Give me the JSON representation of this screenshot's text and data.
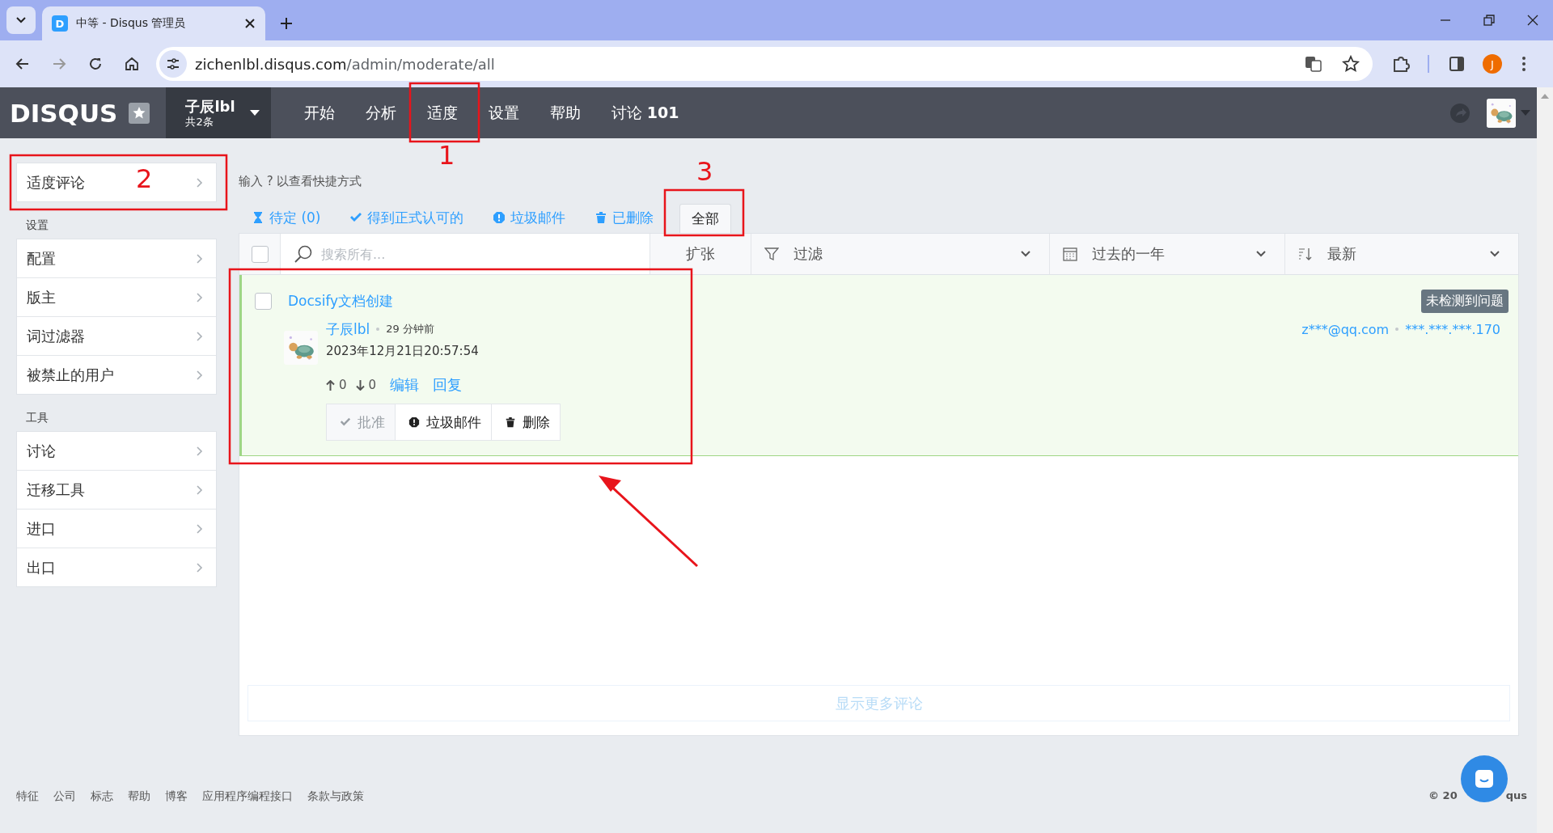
{
  "browser": {
    "tab_title": "中等 - Disqus 管理员",
    "favicon": "D",
    "url": {
      "host": "zichenlbl.disqus.com",
      "path": "/admin/moderate/all"
    },
    "profile_initial": "J"
  },
  "header": {
    "logo": "DISQUS",
    "site": {
      "name": "子辰lbl",
      "count": "共2条"
    },
    "nav": [
      "开始",
      "分析",
      "适度",
      "设置",
      "帮助",
      "讨论 **101**"
    ]
  },
  "sidebar": {
    "top": [
      "适度评论"
    ],
    "sections": [
      {
        "title": "设置",
        "items": [
          "配置",
          "版主",
          "词过滤器",
          "被禁止的用户"
        ]
      },
      {
        "title": "工具",
        "items": [
          "讨论",
          "迁移工具",
          "进口",
          "出口"
        ]
      }
    ]
  },
  "hint": "输入 ? 以查看快捷方式",
  "tabs": [
    {
      "label": "待定 (0)",
      "kind": "hourglass",
      "selected": false
    },
    {
      "label": "得到正式认可的",
      "kind": "check",
      "selected": false
    },
    {
      "label": "垃圾邮件",
      "kind": "spam",
      "selected": false
    },
    {
      "label": "已删除",
      "kind": "trash",
      "selected": false
    },
    {
      "label": "全部",
      "kind": "none",
      "selected": true
    }
  ],
  "toolbar": {
    "select_all_checked": false,
    "search_placeholder": "搜索所有...",
    "expand": "扩张",
    "filter": "过滤",
    "period": "过去的一年",
    "sort": "最新"
  },
  "comments": [
    {
      "checked": false,
      "title": "Docsify文档创建",
      "status": "未检测到问题",
      "author": "子辰lbl",
      "ago": "29 分钟前",
      "date": "2023年12月21日20:57:54",
      "email": "z***@qq.com",
      "ip": "***.***.***.170",
      "upvotes": "0",
      "downvotes": "0",
      "links": [
        "编辑",
        "回复"
      ],
      "actions": [
        {
          "label": "批准",
          "kind": "check",
          "disabled": true
        },
        {
          "label": "垃圾邮件",
          "kind": "spam",
          "disabled": false
        },
        {
          "label": "删除",
          "kind": "trash",
          "disabled": false
        }
      ]
    }
  ],
  "show_more": "显示更多评论",
  "footer": {
    "links": [
      "特征",
      "公司",
      "标志",
      "帮助",
      "博客",
      "应用程序编程接口",
      "条款与政策"
    ],
    "copyright": [
      "© 20",
      "qus"
    ]
  },
  "annotations": [
    "1",
    "2",
    "3"
  ]
}
